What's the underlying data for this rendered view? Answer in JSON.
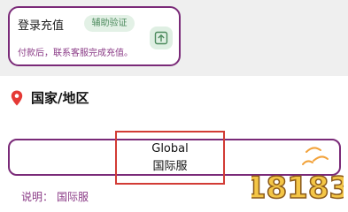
{
  "login_card": {
    "title": "登录充值",
    "badge": "辅助验证",
    "subtitle": "付款后，联系客服完成充值。",
    "action_icon": "upload-icon"
  },
  "region": {
    "icon": "location-pin-icon",
    "title": "国家/地区",
    "selected_en": "Global",
    "selected_cn": "国际服",
    "description_label": "说明：",
    "description_value": "国际服"
  },
  "watermark": {
    "text": "18183"
  },
  "colors": {
    "brand_purple": "#7a2a78",
    "pin_red": "#e53935",
    "highlight_red": "#d23b35",
    "badge_green": "#4c8a5d"
  }
}
